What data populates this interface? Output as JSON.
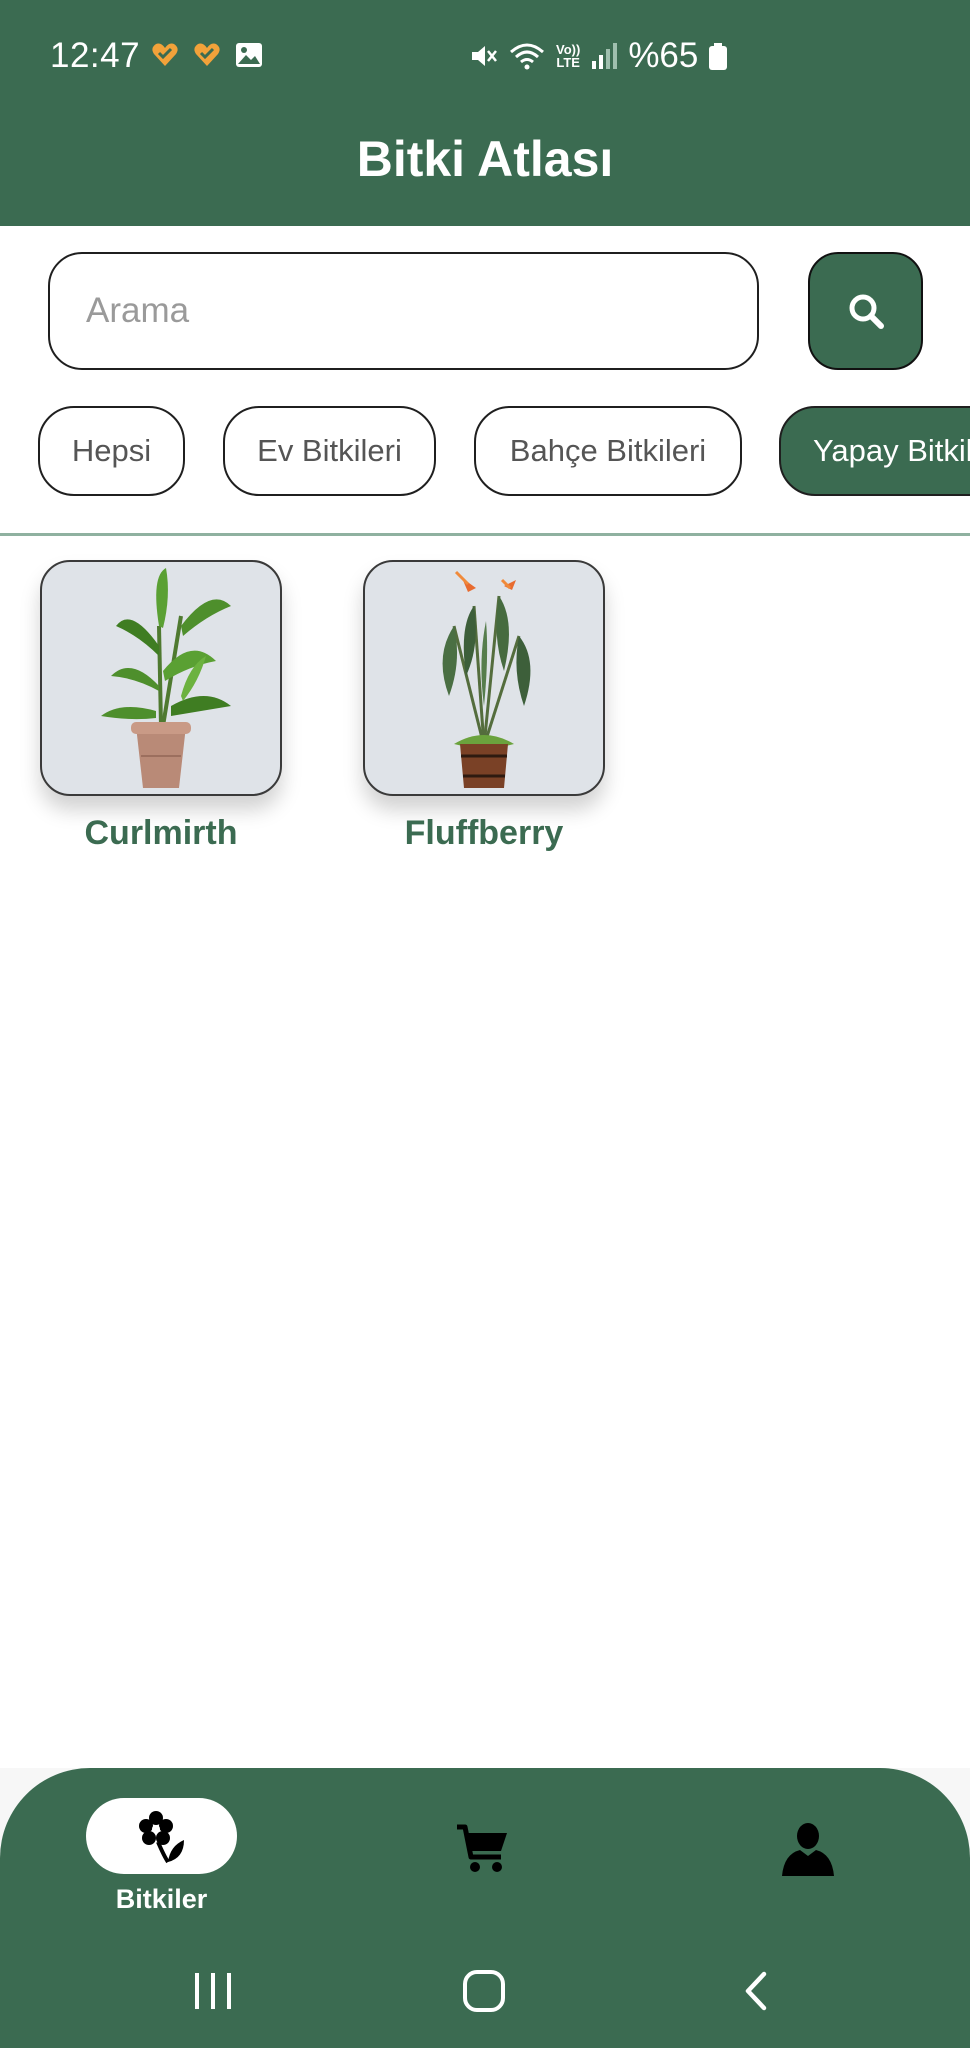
{
  "status_bar": {
    "time": "12:47",
    "battery_percent": "%65",
    "volte_top": "Vo))",
    "volte_bottom": "LTE"
  },
  "header": {
    "title": "Bitki Atlası"
  },
  "search": {
    "placeholder": "Arama",
    "value": ""
  },
  "categories": [
    {
      "label": "Hepsi",
      "active": false
    },
    {
      "label": "Ev Bitkileri",
      "active": false
    },
    {
      "label": "Bahçe Bitkileri",
      "active": false
    },
    {
      "label": "Yapay Bitkiler",
      "active": true
    }
  ],
  "plants": [
    {
      "name": "Curlmirth"
    },
    {
      "name": "Fluffberry"
    }
  ],
  "bottom_nav": {
    "items": [
      {
        "label": "Bitkiler",
        "icon": "flower-icon",
        "active": true
      },
      {
        "label": "",
        "icon": "cart-icon",
        "active": false
      },
      {
        "label": "",
        "icon": "user-icon",
        "active": false
      }
    ]
  },
  "colors": {
    "primary": "#3b6b51",
    "card_bg": "#dfe3e8",
    "divider": "#8fb1a0"
  }
}
